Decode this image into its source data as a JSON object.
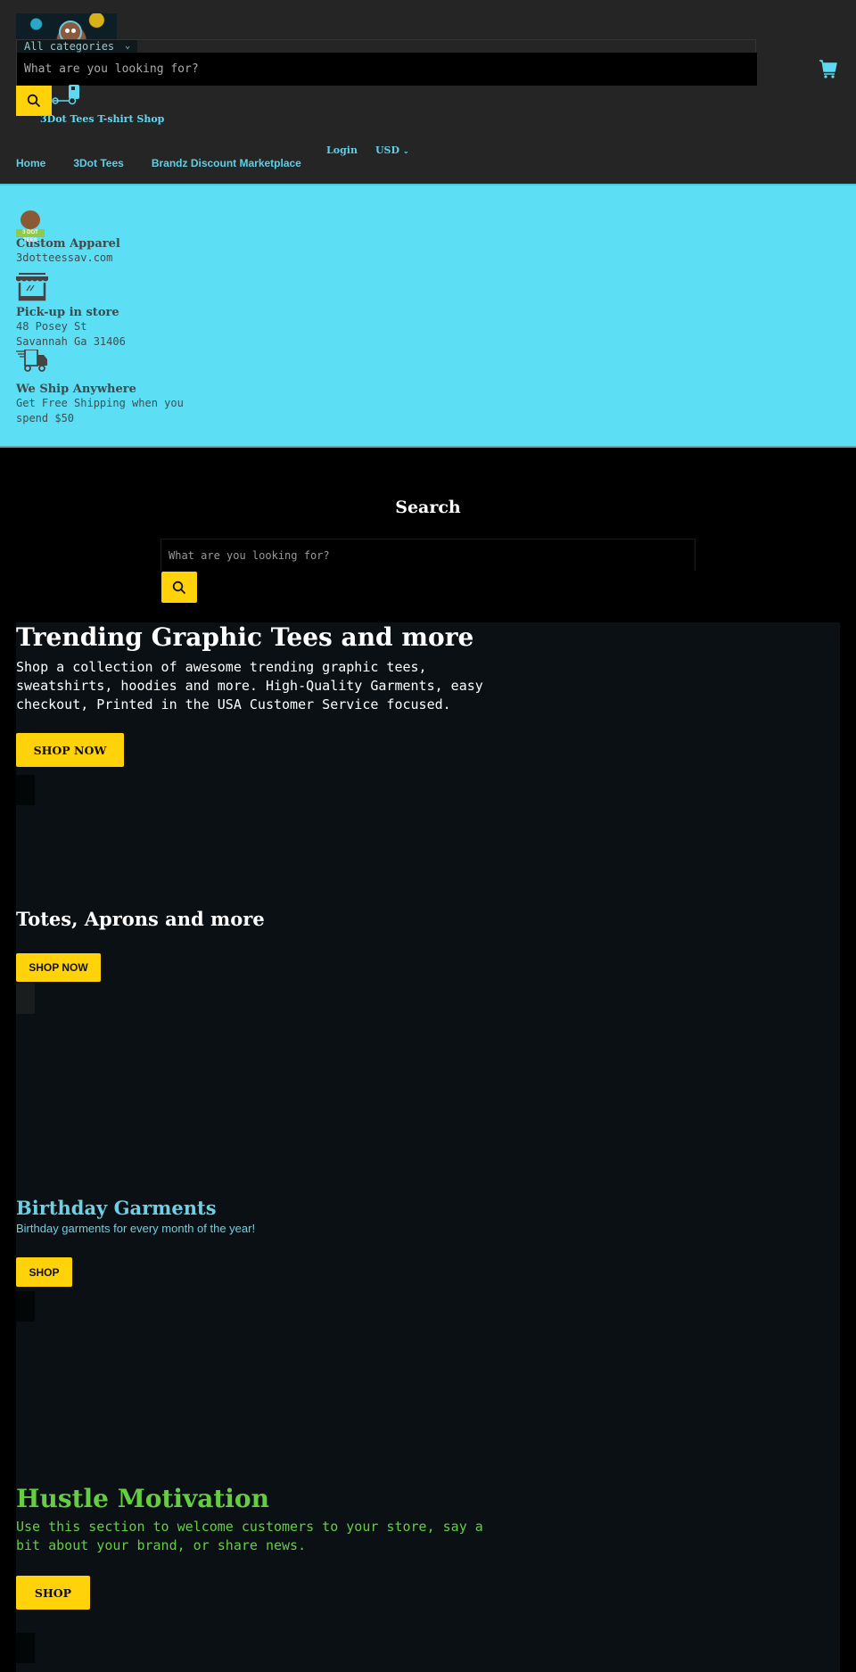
{
  "header": {
    "category_select": "All categories",
    "search_placeholder": "What are you looking for?",
    "shop_name": "3Dot Tees T-shirt Shop",
    "nav": [
      "Home",
      "3Dot Tees",
      "Brandz Discount Marketplace"
    ],
    "login_label": "Login",
    "currency": "USD"
  },
  "info": {
    "items": [
      {
        "title": "Custom Apparel",
        "lines": [
          "3dotteessav.com"
        ],
        "icon": "logo-badge",
        "badge_text": "3 DOT TEES"
      },
      {
        "title": "Pick-up in store",
        "lines": [
          "48 Posey St",
          "Savannah Ga 31406"
        ],
        "icon": "storefront-icon"
      },
      {
        "title": "We Ship Anywhere",
        "lines": [
          "Get Free Shipping when you",
          "spend $50"
        ],
        "icon": "delivery-truck-icon"
      }
    ]
  },
  "search_section": {
    "title": "Search",
    "placeholder": "What are you looking for?"
  },
  "sections": [
    {
      "title": "Trending Graphic Tees and more",
      "text": "Shop a collection of awesome trending graphic tees, sweatshirts, hoodies and more. High-Quality Garments, easy checkout, Printed in the USA Customer Service focused.",
      "button": "SHOP NOW"
    },
    {
      "title": "Totes, Aprons and more",
      "button": "SHOP NOW"
    },
    {
      "title": "Birthday Garments",
      "text": "Birthday garments for every month of the year!",
      "button": "SHOP"
    },
    {
      "title": "Hustle Motivation",
      "text": "Use this section to welcome customers to your store, say a bit about your brand, or share news.",
      "button": "SHOP"
    }
  ],
  "colors": {
    "accent": "#5cdef4",
    "button": "#ffd20a",
    "header_bg": "#262526",
    "section_bg": "#0a1014",
    "birthday_text": "#6fd0e4",
    "hustle_text": "#66cc44"
  }
}
